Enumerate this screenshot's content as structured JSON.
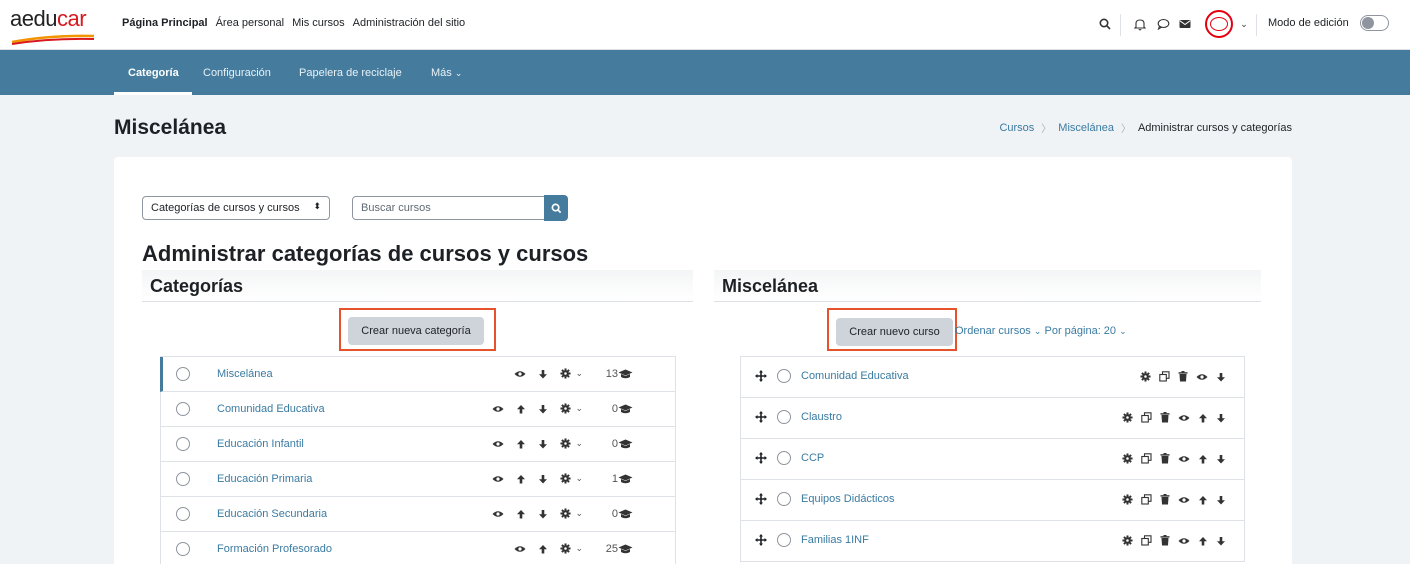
{
  "brand": {
    "logo_main": "aedu",
    "logo_accent": "car"
  },
  "primary_nav": [
    {
      "label": "Página Principal",
      "active": true
    },
    {
      "label": "Área personal",
      "active": false
    },
    {
      "label": "Mis cursos",
      "active": false
    },
    {
      "label": "Administración del sitio",
      "active": false
    }
  ],
  "header_right": {
    "edit_mode_label": "Modo de edición",
    "edit_mode_on": false
  },
  "secondary_nav": {
    "tab_category": "Categoría",
    "tab_config": "Configuración",
    "tab_recycle": "Papelera de reciclaje",
    "tab_more": "Más"
  },
  "page": {
    "title": "Miscelánea",
    "breadcrumb": [
      "Cursos",
      "Miscelánea",
      "Administrar cursos y categorías"
    ]
  },
  "controls": {
    "view_select": "Categorías de cursos y cursos",
    "search_placeholder": "Buscar cursos"
  },
  "main_heading": "Administrar categorías de cursos y cursos",
  "categories_panel": {
    "title": "Categorías",
    "create_button": "Crear nueva categoría",
    "items": [
      {
        "name": "Miscelánea",
        "count": "13",
        "up": false,
        "down": true,
        "active": true
      },
      {
        "name": "Comunidad Educativa",
        "count": "0",
        "up": true,
        "down": true,
        "active": false
      },
      {
        "name": "Educación Infantil",
        "count": "0",
        "up": true,
        "down": true,
        "active": false
      },
      {
        "name": "Educación Primaria",
        "count": "1",
        "up": true,
        "down": true,
        "active": false
      },
      {
        "name": "Educación Secundaria",
        "count": "0",
        "up": true,
        "down": true,
        "active": false
      },
      {
        "name": "Formación Profesorado",
        "count": "25",
        "up": true,
        "down": false,
        "active": false
      }
    ]
  },
  "courses_panel": {
    "title": "Miscelánea",
    "create_button": "Crear nuevo curso",
    "sort_label": "Ordenar cursos",
    "per_page_label": "Por página: 20",
    "items": [
      {
        "name": "Comunidad Educativa",
        "up": false,
        "down": true
      },
      {
        "name": "Claustro",
        "up": true,
        "down": true
      },
      {
        "name": "CCP",
        "up": true,
        "down": true
      },
      {
        "name": "Equipos Didácticos",
        "up": true,
        "down": true
      },
      {
        "name": "Familias 1INF",
        "up": true,
        "down": true
      }
    ]
  },
  "colors": {
    "accent": "#457c9e",
    "link": "#3a7ba2",
    "highlight": "#e6522c",
    "brand_red": "#d71920"
  }
}
